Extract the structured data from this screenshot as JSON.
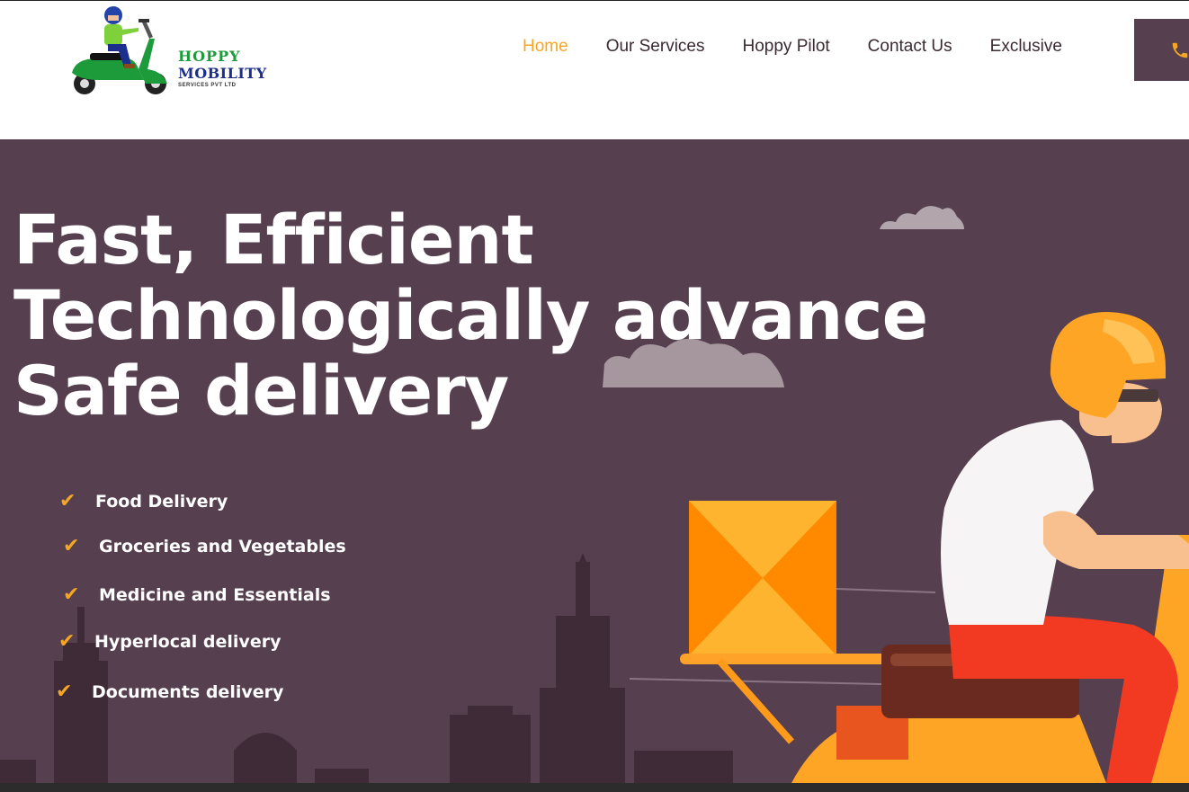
{
  "brand": {
    "line1": "HOPPY",
    "line2": "MOBILITY",
    "line3": "SERVICES PVT LTD"
  },
  "nav": {
    "items": [
      {
        "label": "Home",
        "active": true
      },
      {
        "label": "Our Services",
        "active": false
      },
      {
        "label": "Hoppy Pilot",
        "active": false
      },
      {
        "label": "Contact Us",
        "active": false
      },
      {
        "label": "Exclusive",
        "active": false
      }
    ],
    "call_icon": "phone-icon"
  },
  "hero": {
    "headline": [
      "Fast, Efficient",
      "Technologically advance",
      "Safe delivery"
    ],
    "features": [
      "Food Delivery",
      "Groceries and Vegetables",
      "Medicine and Essentials",
      "Hyperlocal delivery",
      "Documents delivery"
    ],
    "check_icon": "check-icon"
  },
  "colors": {
    "hero_bg": "#563f4f",
    "accent": "#f5a623",
    "nav_text": "#3b2a32",
    "brand_green": "#1d9a3a",
    "brand_blue": "#1d2f8c"
  }
}
